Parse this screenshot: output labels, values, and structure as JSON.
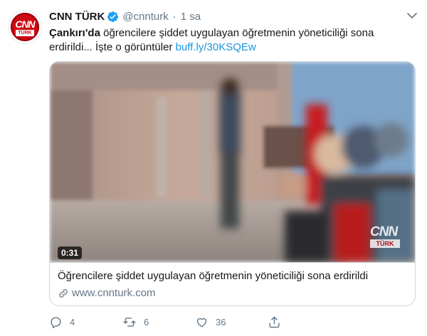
{
  "tweet": {
    "author_name": "CNN TÜRK",
    "handle": "@cnnturk",
    "separator": "·",
    "time": "1 sa",
    "text_bold": "Çankırı'da",
    "text_body": " öğrencilere şiddet uygulayan öğretmenin yöneticiliği sona erdirildi... İşte o görüntüler ",
    "text_link": "buff.ly/30KSQEw"
  },
  "avatar": {
    "logo_top": "CNN",
    "logo_bottom": "TÜRK"
  },
  "media": {
    "duration": "0:31",
    "watermark_top": "CNN",
    "watermark_bottom": "TÜRK"
  },
  "card": {
    "title": "Öğrencilere şiddet uygulayan öğretmenin yöneticiliği sona erdirildi",
    "domain": "www.cnnturk.com"
  },
  "actions": {
    "reply_count": "4",
    "retweet_count": "6",
    "like_count": "36"
  },
  "colors": {
    "accent": "#1b95e0",
    "secondary_text": "#657786",
    "brand_red": "#cc0a13"
  },
  "icons": [
    "cnn-turk-logo",
    "verified-badge-icon",
    "chevron-down-icon",
    "link-icon",
    "reply-icon",
    "retweet-icon",
    "like-icon",
    "share-icon"
  ]
}
